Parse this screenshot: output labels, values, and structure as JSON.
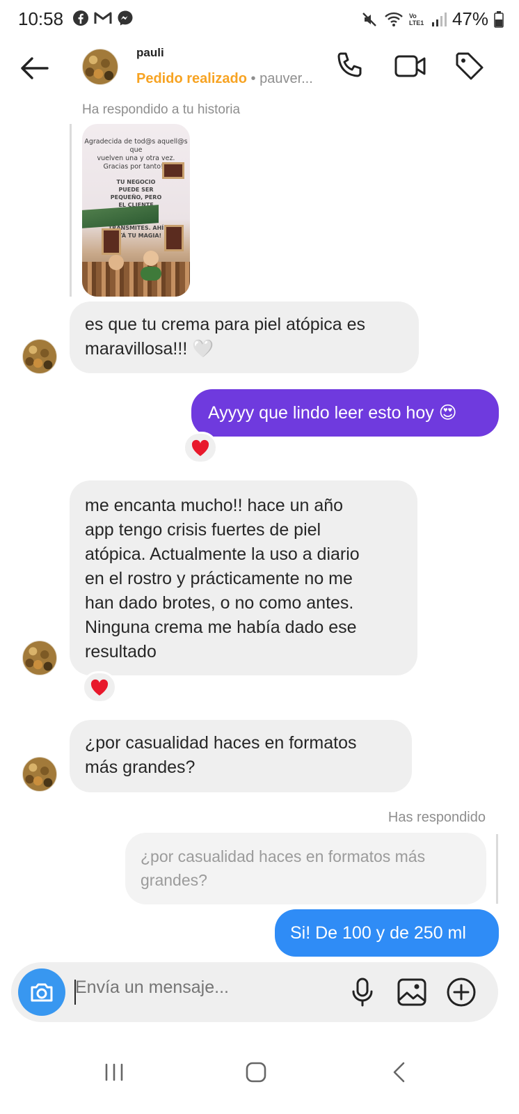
{
  "status_bar": {
    "time": "10:58",
    "notification_icons": [
      "facebook-icon",
      "gmail-icon",
      "messenger-icon"
    ],
    "battery_percent": "47%",
    "network_label": "Vo LTE1"
  },
  "header": {
    "username": "pauli",
    "order_status": "Pedido realizado",
    "separator": "•",
    "handle_preview": "pauver..."
  },
  "story_reply": {
    "caption": "Ha respondido a tu historia",
    "story_text_line1": "Agradecida de tod@s aquell@s que",
    "story_text_line2": "vuelven una y otra vez.",
    "story_text_line3": "Gracias por tanto!!!",
    "story_text_block": "TU NEGOCIO PUEDE SER PEQUEÑO, PERO EL CLIENTE REGRESA POR TODO LO QUE TRANSMITES. AHÍ ESTÁ TU MAGIA!"
  },
  "messages": [
    {
      "id": "m1",
      "direction": "in",
      "text_lines": [
        "es que tu crema para piel atópica es",
        "maravillosa!!! 🤍"
      ]
    },
    {
      "id": "m2",
      "direction": "out",
      "text": "Ayyyy que lindo leer esto hoy 😍",
      "reaction": "❤️"
    },
    {
      "id": "m3",
      "direction": "in",
      "text_lines": [
        "me encanta mucho!! hace un año",
        "app tengo crisis fuertes de piel",
        "atópica. Actualmente la uso a diario",
        "en el rostro y prácticamente no me",
        "han dado brotes, o no como antes.",
        "Ninguna crema me había dado ese",
        "resultado"
      ],
      "reaction": "❤️"
    },
    {
      "id": "m4",
      "direction": "in",
      "text_lines": [
        "¿por casualidad haces en formatos",
        "más grandes?"
      ]
    }
  ],
  "reply": {
    "label": "Has respondido",
    "quoted_lines": [
      "¿por casualidad haces en formatos más",
      "grandes?"
    ],
    "text": "Si! De 100 y de 250 ml"
  },
  "composer": {
    "placeholder": "Envía un mensaje..."
  },
  "colors": {
    "outgoing_purple": "#6f3ade",
    "outgoing_blue": "#2f8cf6",
    "incoming_gray": "#efefef",
    "order_orange": "#f7a322",
    "camera_blue": "#3897f0"
  }
}
